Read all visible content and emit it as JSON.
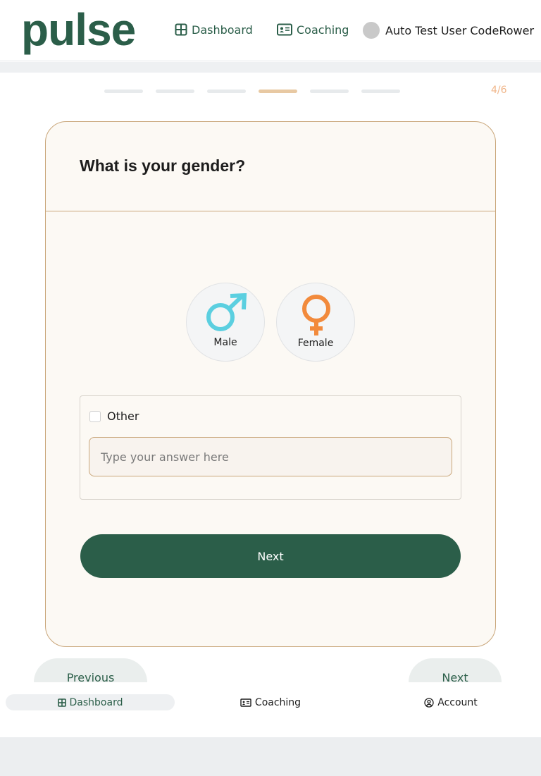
{
  "app": {
    "logo": "pulse",
    "brand_color": "#2b5e49",
    "accent_color": "#c9a67a"
  },
  "header": {
    "nav": [
      {
        "label": "Dashboard",
        "icon": "grid-icon"
      },
      {
        "label": "Coaching",
        "icon": "id-card-icon"
      }
    ],
    "user_name": "Auto Test User CodeRower"
  },
  "progress": {
    "total_steps": 6,
    "current_step": 4,
    "label": "4/6"
  },
  "question": {
    "title": "What is your gender?",
    "options": [
      {
        "label": "Male",
        "icon": "male-symbol-icon",
        "color": "#5bcfe0"
      },
      {
        "label": "Female",
        "icon": "female-symbol-icon",
        "color": "#f28a3c"
      }
    ],
    "other_label": "Other",
    "other_checked": false,
    "answer_placeholder": "Type your answer here",
    "answer_value": "",
    "submit_label": "Next"
  },
  "pager": {
    "previous_label": "Previous",
    "next_label": "Next"
  },
  "tabbar": {
    "items": [
      {
        "label": "Dashboard",
        "icon": "grid-icon",
        "active": true
      },
      {
        "label": "Coaching",
        "icon": "id-card-icon",
        "active": false
      },
      {
        "label": "Account",
        "icon": "user-circle-icon",
        "active": false
      }
    ]
  }
}
